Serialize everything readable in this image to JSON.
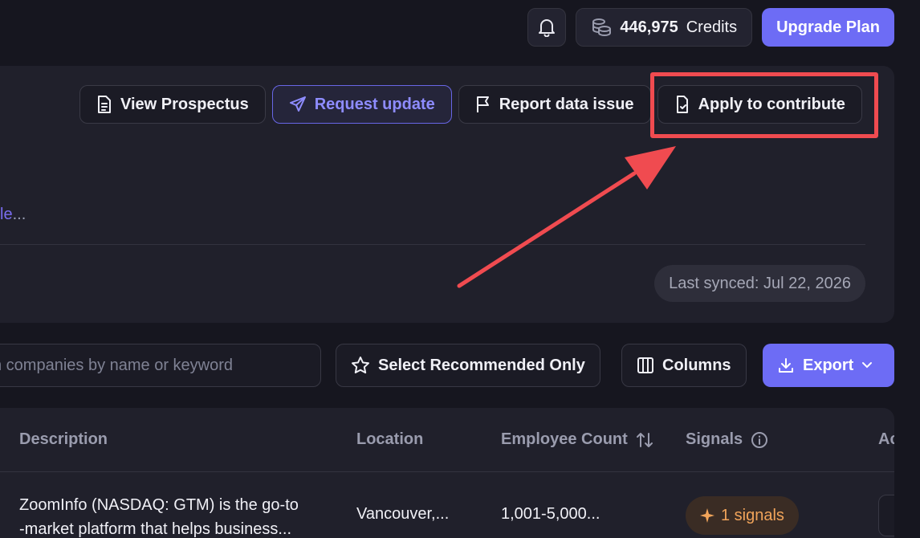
{
  "topbar": {
    "credits_value": "446,975",
    "credits_label": "Credits",
    "upgrade_label": "Upgrade Plan"
  },
  "actions": {
    "view_prospectus": "View Prospectus",
    "request_update": "Request update",
    "report_issue": "Report data issue",
    "apply_contribute": "Apply to contribute"
  },
  "panel": {
    "truncated_link": "le",
    "truncated_dots": "...",
    "last_synced": "Last synced: Jul 22, 2026"
  },
  "toolbar": {
    "search_placeholder": "h companies by name or keyword",
    "select_recommended": "Select Recommended Only",
    "columns": "Columns",
    "export": "Export"
  },
  "table": {
    "headers": {
      "description": "Description",
      "location": "Location",
      "employee_count": "Employee Count",
      "signals": "Signals",
      "actions_partial": "Ac"
    },
    "rows": [
      {
        "description_line1": "ZoomInfo (NASDAQ: GTM) is the go-to",
        "description_line2": "-market platform that helps business...",
        "location": "Vancouver,...",
        "employee_count": "1,001-5,000...",
        "signals": "1 signals"
      }
    ]
  },
  "colors": {
    "accent": "#6d6cf5",
    "annotation": "#f04b50",
    "signal": "#f1a45a"
  }
}
